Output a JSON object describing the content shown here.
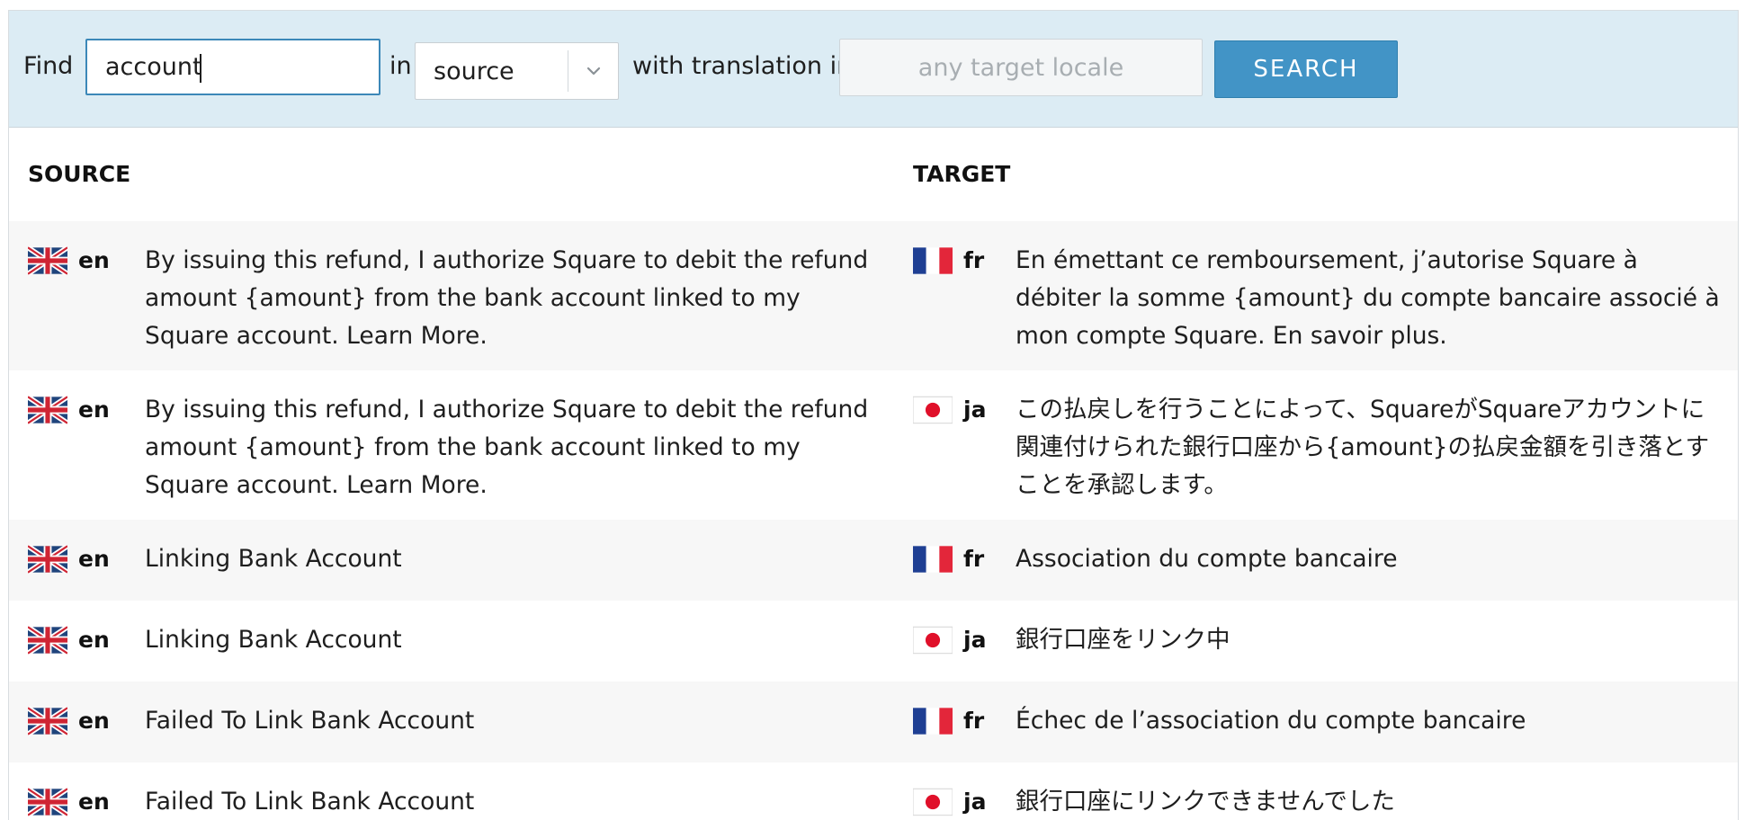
{
  "search": {
    "find_label": "Find",
    "query_value": "account",
    "in_label": "in",
    "field_selected": "source",
    "translation_label": "with translation in",
    "target_placeholder": "any target locale",
    "button_label": "SEARCH"
  },
  "table": {
    "headers": {
      "source": "SOURCE",
      "target": "TARGET"
    },
    "rows": [
      {
        "source_locale": "en",
        "source_flag": "uk-flag-icon",
        "source_text": "By issuing this refund, I authorize Square to debit the refund amount {amount} from the bank account linked to my Square account. Learn More.",
        "target_locale": "fr",
        "target_flag": "france-flag-icon",
        "target_text": "En émettant ce remboursement, j’autorise Square à débiter la somme {amount} du compte bancaire associé à mon compte Square. En savoir plus."
      },
      {
        "source_locale": "en",
        "source_flag": "uk-flag-icon",
        "source_text": "By issuing this refund, I authorize Square to debit the refund amount {amount} from the bank account linked to my Square account. Learn More.",
        "target_locale": "ja",
        "target_flag": "japan-flag-icon",
        "target_text": "この払戻しを行うことによって、SquareがSquareアカウントに関連付けられた銀行口座から{amount}の払戻金額を引き落とすことを承認します。"
      },
      {
        "source_locale": "en",
        "source_flag": "uk-flag-icon",
        "source_text": "Linking Bank Account",
        "target_locale": "fr",
        "target_flag": "france-flag-icon",
        "target_text": "Association du compte bancaire"
      },
      {
        "source_locale": "en",
        "source_flag": "uk-flag-icon",
        "source_text": "Linking Bank Account",
        "target_locale": "ja",
        "target_flag": "japan-flag-icon",
        "target_text": "銀行口座をリンク中"
      },
      {
        "source_locale": "en",
        "source_flag": "uk-flag-icon",
        "source_text": "Failed To Link Bank Account",
        "target_locale": "fr",
        "target_flag": "france-flag-icon",
        "target_text": "Échec de l’association du compte bancaire"
      },
      {
        "source_locale": "en",
        "source_flag": "uk-flag-icon",
        "source_text": "Failed To Link Bank Account",
        "target_locale": "ja",
        "target_flag": "japan-flag-icon",
        "target_text": "銀行口座にリンクできませんでした"
      }
    ]
  },
  "colors": {
    "search_bar_bg": "#dcecf4",
    "button_bg": "#4294c6",
    "input_focus_border": "#3c88b8",
    "row_alt_bg": "#f7f7f7"
  }
}
